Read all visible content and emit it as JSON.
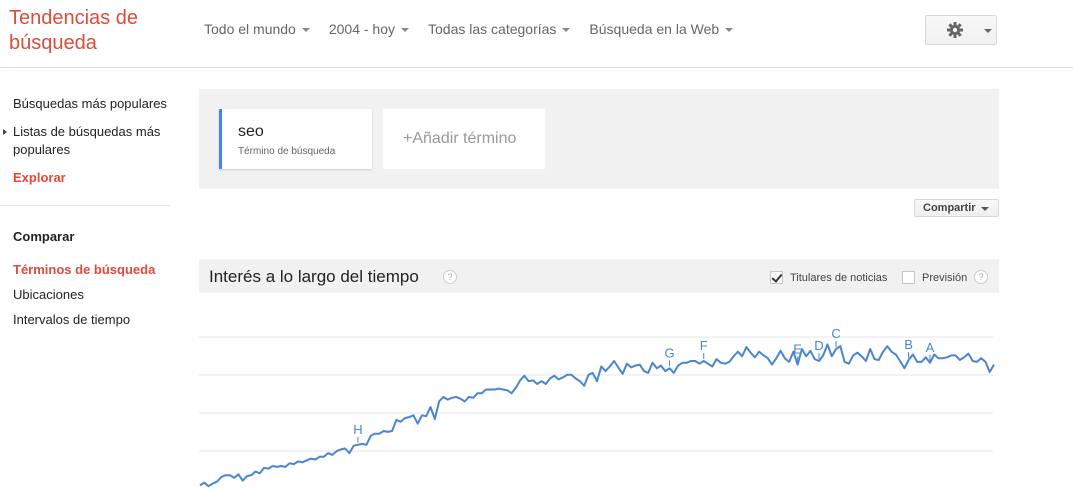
{
  "header": {
    "logo": "Tendencias de búsqueda",
    "filters": [
      {
        "label": "Todo el mundo"
      },
      {
        "label": "2004 - hoy"
      },
      {
        "label": "Todas las categorías"
      },
      {
        "label": "Búsqueda en la Web"
      }
    ]
  },
  "sidebar": {
    "top_items": [
      {
        "label": "Búsquedas más populares"
      },
      {
        "label": "Listas de búsquedas más populares"
      },
      {
        "label": "Explorar"
      }
    ],
    "compare_heading": "Comparar",
    "compare_items": [
      {
        "label": "Términos de búsqueda"
      },
      {
        "label": "Ubicaciones"
      },
      {
        "label": "Intervalos de tiempo"
      }
    ]
  },
  "terms": {
    "term": "seo",
    "term_sub": "Término de búsqueda",
    "add_label": "+Añadir término",
    "term_color": "#4285f4"
  },
  "share_label": "Compartir",
  "interest": {
    "title": "Interés a lo largo del tiempo",
    "help_glyph": "?",
    "news_label": "Titulares de noticias",
    "news_checked": true,
    "forecast_label": "Previsión",
    "forecast_checked": false
  },
  "chart_data": {
    "type": "line",
    "series": [
      {
        "name": "seo",
        "color": "#4a86cf",
        "values": [
          4,
          7,
          3,
          6,
          8,
          13,
          15,
          15,
          12,
          16,
          9,
          14,
          15,
          19,
          17,
          23,
          22,
          25,
          24,
          25,
          24,
          28,
          27,
          30,
          29,
          31,
          33,
          32,
          35,
          35,
          39,
          37,
          41,
          43,
          44,
          39,
          47,
          48,
          49,
          48,
          58,
          60,
          60,
          63,
          62,
          63,
          75,
          73,
          77,
          78,
          80,
          71,
          80,
          79,
          89,
          76,
          95,
          100,
          97,
          99,
          100,
          98,
          95,
          100,
          99,
          104,
          104,
          108,
          108,
          108,
          109,
          108,
          107,
          104,
          110,
          118,
          123,
          117,
          118,
          114,
          117,
          114,
          120,
          123,
          119,
          121,
          124,
          124,
          120,
          117,
          112,
          124,
          126,
          117,
          133,
          128,
          133,
          139,
          132,
          125,
          136,
          132,
          134,
          135,
          128,
          126,
          137,
          131,
          134,
          128,
          131,
          126,
          134,
          137,
          137,
          139,
          139,
          136,
          139,
          136,
          133,
          141,
          137,
          136,
          138,
          144,
          149,
          144,
          154,
          148,
          143,
          149,
          145,
          142,
          135,
          142,
          150,
          142,
          138,
          149,
          135,
          152,
          144,
          150,
          141,
          139,
          145,
          157,
          144,
          152,
          155,
          138,
          136,
          145,
          148,
          144,
          139,
          152,
          141,
          140,
          149,
          155,
          149,
          146,
          139,
          131,
          140,
          146,
          138,
          138,
          143,
          137,
          146,
          142,
          142,
          143,
          145,
          145,
          140,
          143,
          147,
          139,
          138,
          142,
          138,
          127,
          135
        ],
        "max_displayed": 165
      }
    ],
    "annotations": [
      {
        "label": "H",
        "index": 37
      },
      {
        "label": "G",
        "index": 110
      },
      {
        "label": "F",
        "index": 118
      },
      {
        "label": "E",
        "index": 140
      },
      {
        "label": "D",
        "index": 145
      },
      {
        "label": "C",
        "index": 149
      },
      {
        "label": "B",
        "index": 166
      },
      {
        "label": "A",
        "index": 171
      }
    ],
    "grid": true,
    "gridline_count": 4,
    "line_color": "#4a86cf",
    "grid_color": "#e5e5e5",
    "title": "",
    "xlabel": "",
    "ylabel": ""
  }
}
